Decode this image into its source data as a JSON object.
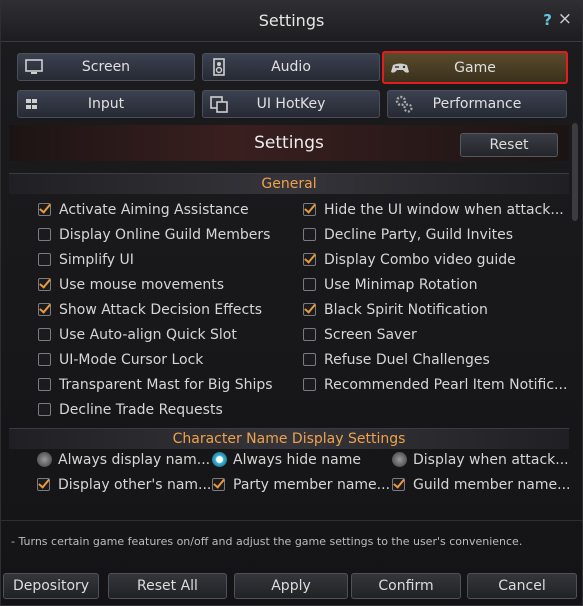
{
  "window": {
    "title": "Settings",
    "help": "?",
    "close": "×"
  },
  "tabs": [
    {
      "label": "Screen",
      "icon": "monitor-icon",
      "active": false
    },
    {
      "label": "Audio",
      "icon": "speaker-icon",
      "active": false
    },
    {
      "label": "Game",
      "icon": "gamepad-icon",
      "active": true
    },
    {
      "label": "Input",
      "icon": "keyboard-icon",
      "active": false
    },
    {
      "label": "UI HotKey",
      "icon": "window-icon",
      "active": false
    },
    {
      "label": "Performance",
      "icon": "gears-icon",
      "active": false
    }
  ],
  "panel": {
    "title": "Settings",
    "reset_label": "Reset"
  },
  "general": {
    "title": "General",
    "left": [
      {
        "label": "Activate Aiming Assistance",
        "checked": true
      },
      {
        "label": "Display Online Guild Members",
        "checked": false
      },
      {
        "label": "Simplify UI",
        "checked": false
      },
      {
        "label": "Use mouse movements",
        "checked": true
      },
      {
        "label": "Show Attack Decision Effects",
        "checked": true
      },
      {
        "label": "Use Auto-align Quick Slot",
        "checked": false
      },
      {
        "label": "UI-Mode Cursor Lock",
        "checked": false
      },
      {
        "label": "Transparent Mast for Big Ships",
        "checked": false
      },
      {
        "label": "Decline Trade Requests",
        "checked": false
      }
    ],
    "right": [
      {
        "label": "Hide the UI window when attack...",
        "checked": true
      },
      {
        "label": "Decline Party, Guild Invites",
        "checked": false
      },
      {
        "label": "Display Combo video guide",
        "checked": true
      },
      {
        "label": "Use Minimap Rotation",
        "checked": false
      },
      {
        "label": "Black Spirit Notification",
        "checked": true
      },
      {
        "label": "Screen Saver",
        "checked": false
      },
      {
        "label": "Refuse Duel Challenges",
        "checked": false
      },
      {
        "label": "Recommended Pearl Item Notific...",
        "checked": false
      }
    ]
  },
  "name_display": {
    "title": "Character Name Display Settings",
    "radios": [
      {
        "label": "Always display nam...",
        "selected": false
      },
      {
        "label": "Always hide name",
        "selected": true
      },
      {
        "label": "Display when attack...",
        "selected": false
      }
    ],
    "checks": [
      {
        "label": "Display other's nam...",
        "checked": true
      },
      {
        "label": "Party member name...",
        "checked": true
      },
      {
        "label": "Guild member name...",
        "checked": true
      }
    ]
  },
  "description": "- Turns certain game features on/off and adjust the game settings to the user's convenience.",
  "footer": {
    "depository": "Depository",
    "reset_all": "Reset All",
    "apply": "Apply",
    "confirm": "Confirm",
    "cancel": "Cancel"
  },
  "colors": {
    "accent": "#e89a3c",
    "section_title": "#f0a24a",
    "active_border": "#e21d1d",
    "radio_on": "#39b4d8"
  }
}
